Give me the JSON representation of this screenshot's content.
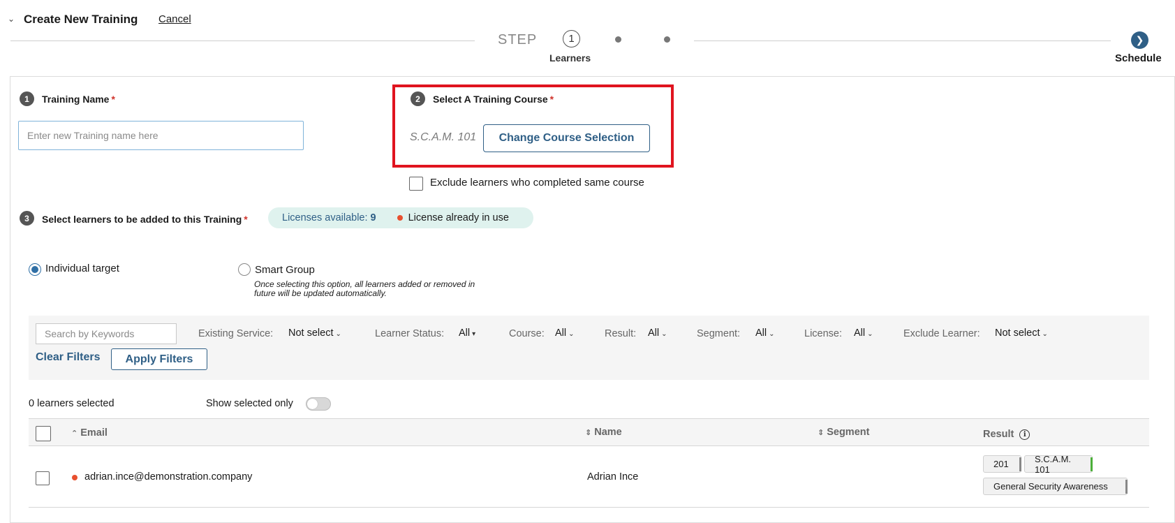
{
  "header": {
    "title": "Create New Training",
    "cancel": "Cancel"
  },
  "stepper": {
    "step_label": "STEP",
    "current_number": "1",
    "current_name": "Learners",
    "final_name": "Schedule"
  },
  "section1": {
    "number": "1",
    "label": "Training Name",
    "required_mark": "*",
    "input_placeholder": "Enter new Training name here",
    "input_value": ""
  },
  "section2": {
    "number": "2",
    "label": "Select A Training Course",
    "required_mark": "*",
    "course_name": "S.C.A.M. 101",
    "change_button": "Change Course Selection",
    "exclude_label": "Exclude learners who completed same course",
    "exclude_checked": false
  },
  "section3": {
    "number": "3",
    "label": "Select learners to be added to this Training",
    "required_mark": "*",
    "licenses_label": "Licenses available:",
    "licenses_count": "9",
    "license_in_use": "License already in use"
  },
  "targeting": {
    "individual_label": "Individual target",
    "individual_selected": true,
    "smart_label": "Smart Group",
    "smart_note": "Once selecting this option, all learners added or removed in future will be updated automatically."
  },
  "filters": {
    "search_placeholder": "Search by Keywords",
    "items": [
      {
        "label": "Existing Service:",
        "value": "Not select"
      },
      {
        "label": "Learner Status:",
        "value": "All"
      },
      {
        "label": "Course:",
        "value": "All"
      },
      {
        "label": "Result:",
        "value": "All"
      },
      {
        "label": "Segment:",
        "value": "All"
      },
      {
        "label": "License:",
        "value": "All"
      },
      {
        "label": "Exclude Learner:",
        "value": "Not select"
      }
    ],
    "clear": "Clear Filters",
    "apply": "Apply Filters"
  },
  "selection": {
    "count_text": "0 learners selected",
    "show_selected": "Show selected only",
    "show_selected_on": false
  },
  "table": {
    "columns": [
      "Email",
      "Name",
      "Segment",
      "Result"
    ],
    "rows": [
      {
        "email": "adrian.ince@demonstration.company",
        "name": "Adrian Ince",
        "segment": "",
        "results": [
          "201",
          "S.C.A.M. 101",
          "General Security Awareness"
        ]
      }
    ]
  },
  "colors": {
    "accent": "#2f5f86",
    "required": "#d0342c",
    "highlight_box": "#e0141f",
    "license_pill_bg": "#dff2ee",
    "in_use_dot": "#e8502f",
    "result_pass": "#4caf3a"
  }
}
